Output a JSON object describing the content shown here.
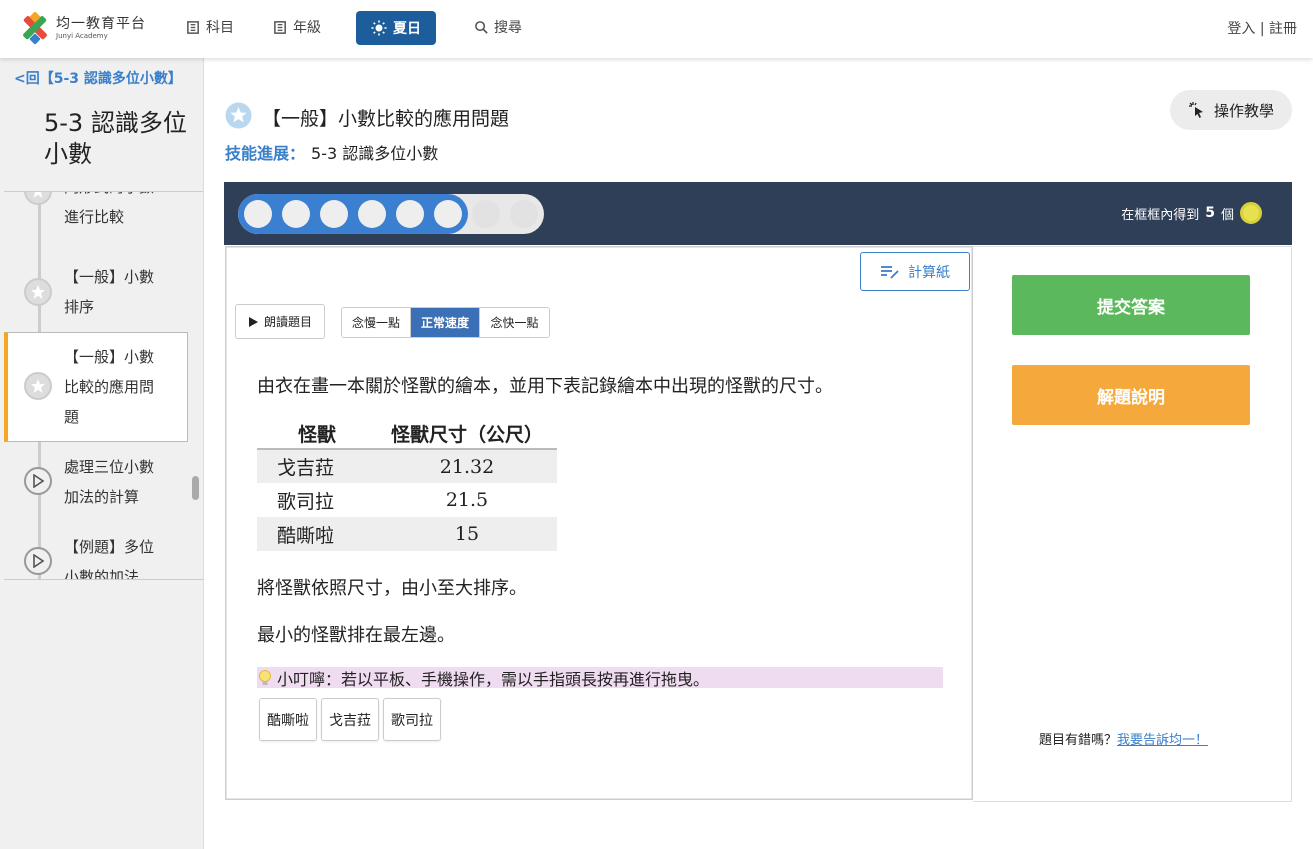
{
  "nav": {
    "logo_cn": "均一教育平台",
    "logo_en": "Junyi Academy",
    "subjects": "科目",
    "grades": "年級",
    "summer": "夏日",
    "search": "搜尋",
    "login": "登入",
    "divider": "|",
    "register": "註冊"
  },
  "sidebar": {
    "back": "<回【5-3 認識多位小數】",
    "title": "5-3 認識多位小數",
    "items": [
      {
        "line1": "同形式的小數",
        "line2": "進行比較",
        "line3": ""
      },
      {
        "line1": "【一般】小數",
        "line2": "排序",
        "line3": ""
      },
      {
        "line1": "【一般】小數",
        "line2": "比較的應用問",
        "line3": "題"
      },
      {
        "line1": "處理三位小數",
        "line2": "加法的計算",
        "line3": ""
      },
      {
        "line1": "【例題】多位",
        "line2": "小數的加法",
        "line3": ""
      }
    ]
  },
  "exercise": {
    "title": "【一般】小數比較的應用問題",
    "progress_label": "技能進展：",
    "progress_value": "5-3 認識多位小數",
    "tutorial": "操作教學"
  },
  "streak": {
    "filled": 6,
    "total": 8,
    "note_prefix": "在框框內得到",
    "note_count": "5",
    "note_suffix": "個"
  },
  "problem": {
    "calc_paper": "計算紙",
    "read_aloud": "朗讀題目",
    "speeds": [
      "念慢一點",
      "正常速度",
      "念快一點"
    ],
    "speed_selected": "正常速度",
    "intro": "由衣在畫一本關於怪獸的繪本，並用下表記錄繪本中出現的怪獸的尺寸。",
    "table": {
      "headers": [
        "怪獸",
        "怪獸尺寸（公尺）"
      ],
      "rows": [
        [
          "戈吉菈",
          "21.32"
        ],
        [
          "歌司拉",
          "21.5"
        ],
        [
          "酷嘶啦",
          "15"
        ]
      ]
    },
    "instruction1": "將怪獸依照尺寸，由小至大排序。",
    "instruction2": "最小的怪獸排在最左邊。",
    "tip": "小叮嚀：若以平板、手機操作，需以手指頭長按再進行拖曳。",
    "chips": [
      "酷嘶啦",
      "戈吉菈",
      "歌司拉"
    ]
  },
  "actions": {
    "submit": "提交答案",
    "hint": "解題說明",
    "report_text": "題目有錯嗎？",
    "report_link": "我要告訴均一！"
  },
  "colors": {
    "accent_blue": "#3a7fc9",
    "nav_active": "#1d5d9b",
    "dark_bar": "#2e3f57",
    "progress_fill": "#3b7fd0",
    "submit_green": "#5cb85c",
    "hint_orange": "#f5a83c",
    "active_marker": "#f5a623"
  }
}
